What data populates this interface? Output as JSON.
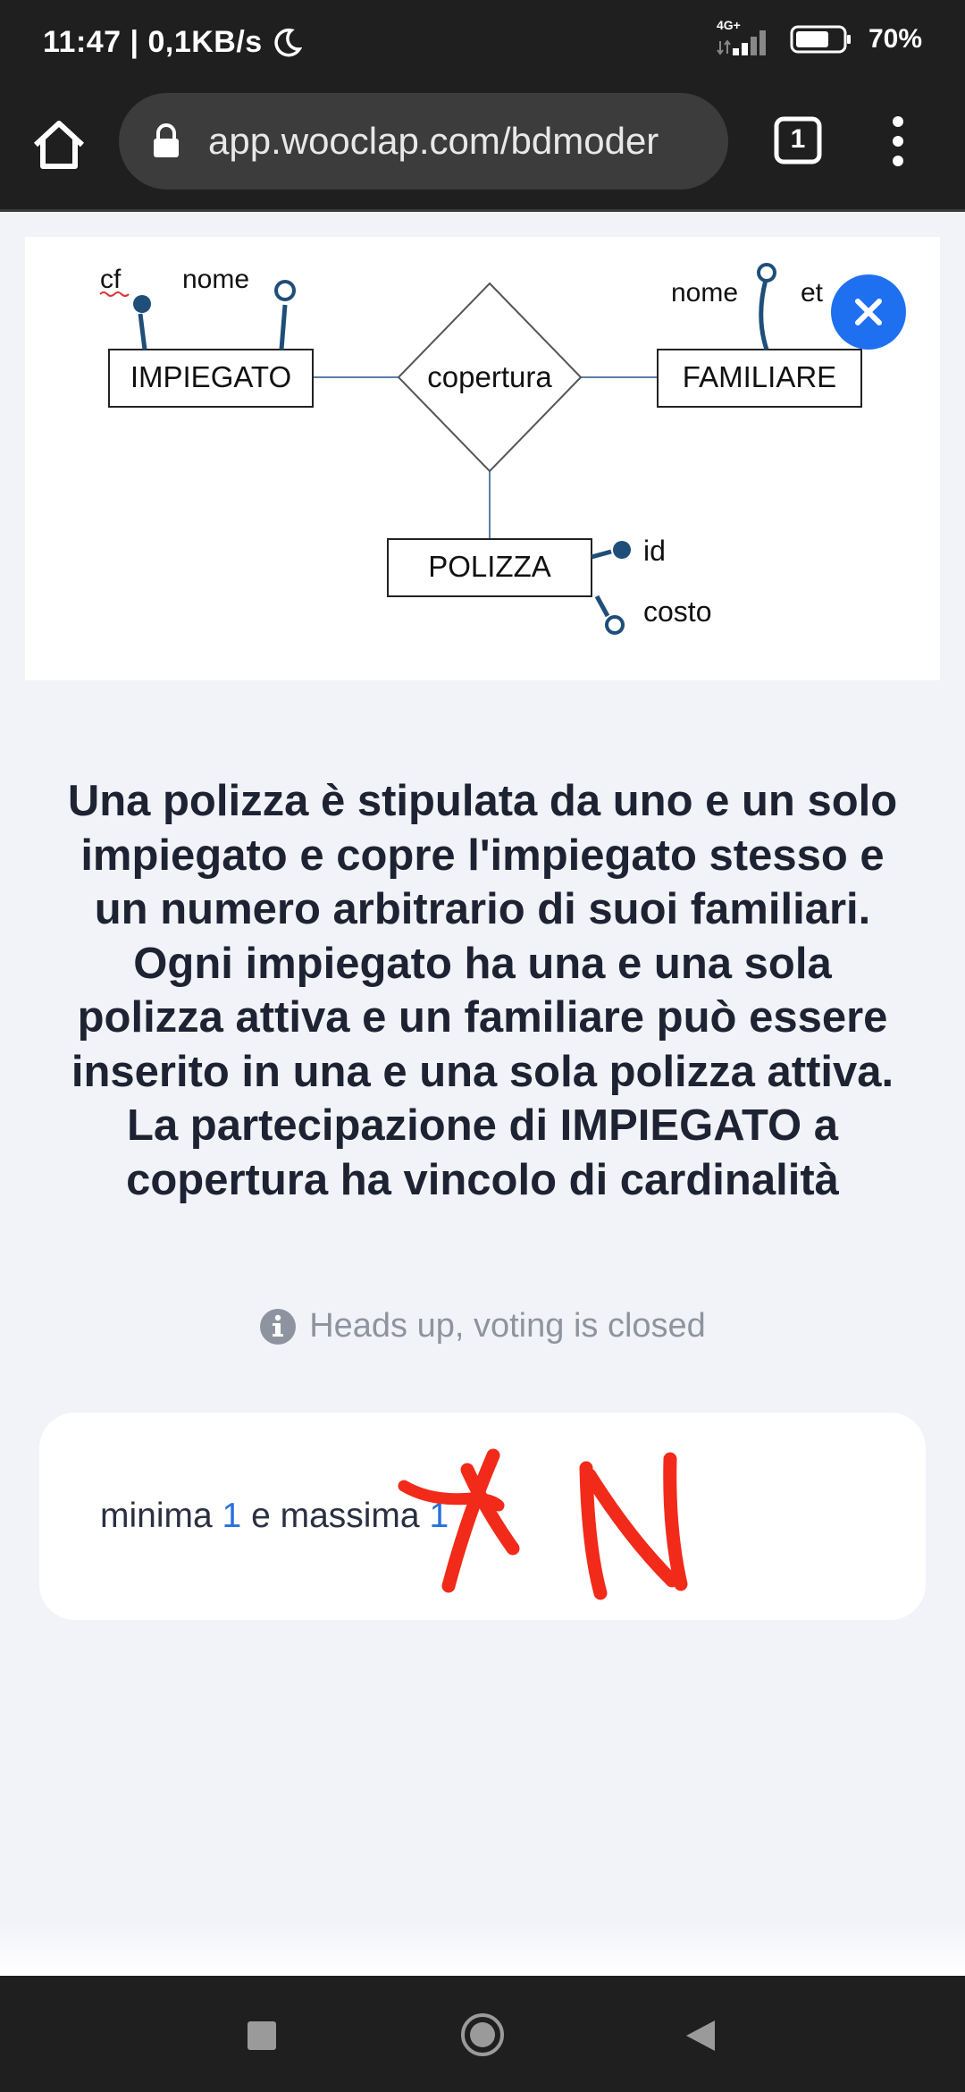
{
  "status_bar": {
    "time_speed": "11:47 | 0,1KB/s",
    "network": "4G+",
    "battery": "70%"
  },
  "browser": {
    "url": "app.wooclap.com/bdmoder",
    "tab_count": "1"
  },
  "diagram": {
    "entities": {
      "impiegato": "IMPIEGATO",
      "familiare": "FAMILIARE",
      "polizza": "POLIZZA"
    },
    "relationship": "copertura",
    "attributes": {
      "impiegato_cf": "cf",
      "impiegato_nome": "nome",
      "familiare_nome": "nome",
      "familiare_eta": "et",
      "polizza_id": "id",
      "polizza_costo": "costo"
    }
  },
  "question": {
    "lines": [
      "Una polizza è stipulata da uno e un solo",
      "impiegato e copre l'impiegato stesso e",
      "un numero arbitrario di suoi familiari.",
      "Ogni impiegato ha una e una sola",
      "polizza attiva e un familiare può essere",
      "inserito in una e una sola polizza attiva.",
      "La partecipazione di IMPIEGATO a",
      "copertura ha vincolo di cardinalità"
    ]
  },
  "notice": {
    "text": "Heads up, voting is closed",
    "icon": "info-icon"
  },
  "answer": {
    "prefix": "minima ",
    "min_value": "1",
    "middle": " e massima ",
    "max_value": "1"
  },
  "colors": {
    "accent": "#1f70f0",
    "annotation_red": "#f22a1a",
    "diagram_lines": "#1f4e79"
  }
}
